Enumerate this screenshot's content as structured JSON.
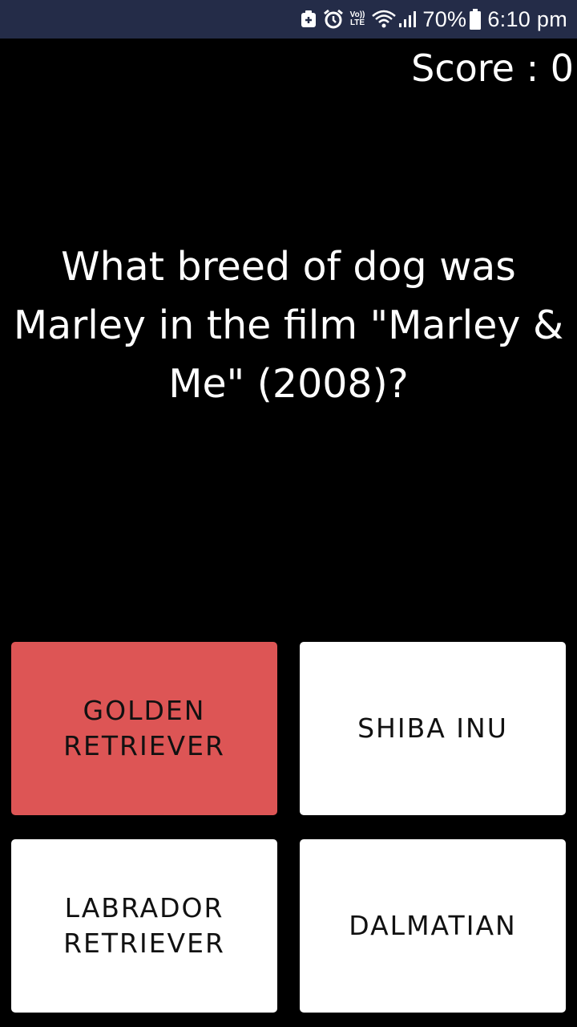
{
  "status_bar": {
    "lte_line1": "Vo))",
    "lte_line2": "LTE",
    "battery_percent": "70%",
    "time": "6:10 pm",
    "icons": [
      "notification-icon",
      "alarm-icon",
      "volte-icon",
      "wifi-icon",
      "signal-icon",
      "battery-icon"
    ],
    "background_color": "#242c48"
  },
  "score": {
    "label": "Score : 0"
  },
  "question": {
    "text": "What breed of dog was Marley in the film \"Marley & Me\" (2008)?"
  },
  "answers": [
    {
      "label": "GOLDEN RETRIEVER",
      "selected": true,
      "color": "#dd5555"
    },
    {
      "label": "SHIBA INU",
      "selected": false,
      "color": "#ffffff"
    },
    {
      "label": "LABRADOR RETRIEVER",
      "selected": false,
      "color": "#ffffff"
    },
    {
      "label": "DALMATIAN",
      "selected": false,
      "color": "#ffffff"
    }
  ]
}
